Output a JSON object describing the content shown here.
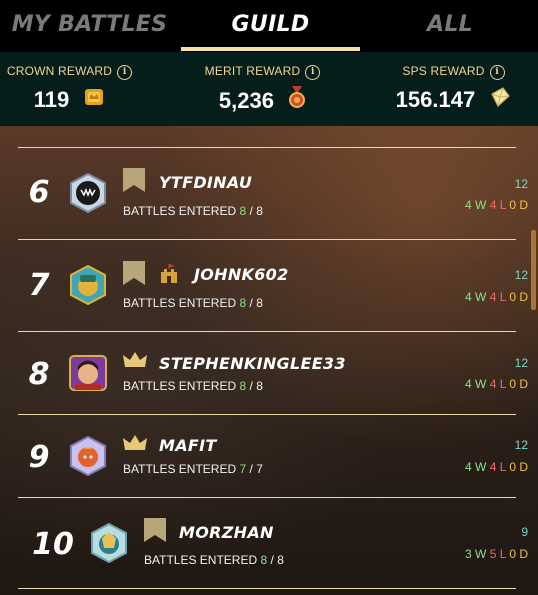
{
  "tabs": [
    {
      "label": "MY BATTLES",
      "active": false
    },
    {
      "label": "GUILD",
      "active": true
    },
    {
      "label": "ALL",
      "active": false
    }
  ],
  "rewards": {
    "crown": {
      "label": "CROWN REWARD",
      "value": "119",
      "icon": "crown-token-icon"
    },
    "merit": {
      "label": "MERIT REWARD",
      "value": "5,236",
      "icon": "merit-medal-icon"
    },
    "sps": {
      "label": "SPS REWARD",
      "value": "156.147",
      "icon": "sps-crystal-icon"
    }
  },
  "battles_label": "BATTLES ENTERED",
  "players": [
    {
      "rank": "6",
      "name": "YTFDINAU",
      "entered": "8",
      "total": "8",
      "score": "12",
      "w": "4",
      "l": "4",
      "d": "0",
      "badge": "bookmark"
    },
    {
      "rank": "7",
      "name": "JOHNK602",
      "entered": "8",
      "total": "8",
      "score": "12",
      "w": "4",
      "l": "4",
      "d": "0",
      "badge": "bookmark"
    },
    {
      "rank": "8",
      "name": "STEPHENKINGLEE33",
      "entered": "8",
      "total": "8",
      "score": "12",
      "w": "4",
      "l": "4",
      "d": "0",
      "badge": "crown"
    },
    {
      "rank": "9",
      "name": "MAFIT",
      "entered": "7",
      "total": "7",
      "score": "12",
      "w": "4",
      "l": "4",
      "d": "0",
      "badge": "crown"
    },
    {
      "rank": "10",
      "name": "MORZHAN",
      "entered": "8",
      "total": "8",
      "score": "9",
      "w": "3",
      "l": "5",
      "d": "0",
      "badge": "bookmark"
    }
  ],
  "colors": {
    "win": "#8ee08a",
    "loss": "#f06a6a",
    "draw": "#f0c04c",
    "score": "#7dd6cc",
    "accent": "#f3e3a4"
  }
}
